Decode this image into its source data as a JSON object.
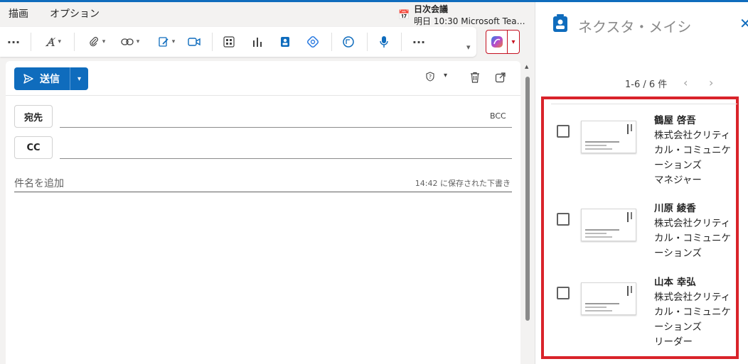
{
  "tabs": [
    "描画",
    "オプション"
  ],
  "meeting": {
    "title": "日次会議",
    "subtitle": "明日 10:30 Microsoft Teams ..."
  },
  "toolbar": {
    "more_label": "···",
    "icons": [
      "more-icon",
      "editor-icon",
      "attach-icon",
      "link-icon",
      "signature-icon",
      "video-icon",
      "apps-icon",
      "poll-icon",
      "contact-icon",
      "loop-icon",
      "chat-icon",
      "mic-icon",
      "more-icon"
    ]
  },
  "compose": {
    "send_label": "送信",
    "to_label": "宛先",
    "cc_label": "CC",
    "bcc_label": "BCC",
    "subject_placeholder": "件名を追加",
    "saved_status": "14:42 に保存された下書き"
  },
  "pane": {
    "title": "ネクスタ・メイシ",
    "pager": "1-6 / 6 件",
    "contacts": [
      {
        "name": "鶴屋 啓吾",
        "lines": [
          "株式会社クリティ",
          "カル・コミュニケ",
          "ーションズ",
          "マネジャー"
        ]
      },
      {
        "name": "川原 綾香",
        "lines": [
          "株式会社クリティ",
          "カル・コミュニケ",
          "ーションズ"
        ]
      },
      {
        "name": "山本 幸弘",
        "lines": [
          "株式会社クリティ",
          "カル・コミュニケ",
          "ーションズ",
          "リーダー"
        ]
      }
    ]
  },
  "colors": {
    "accent": "#0f6cbd",
    "highlight": "#d9232a"
  }
}
